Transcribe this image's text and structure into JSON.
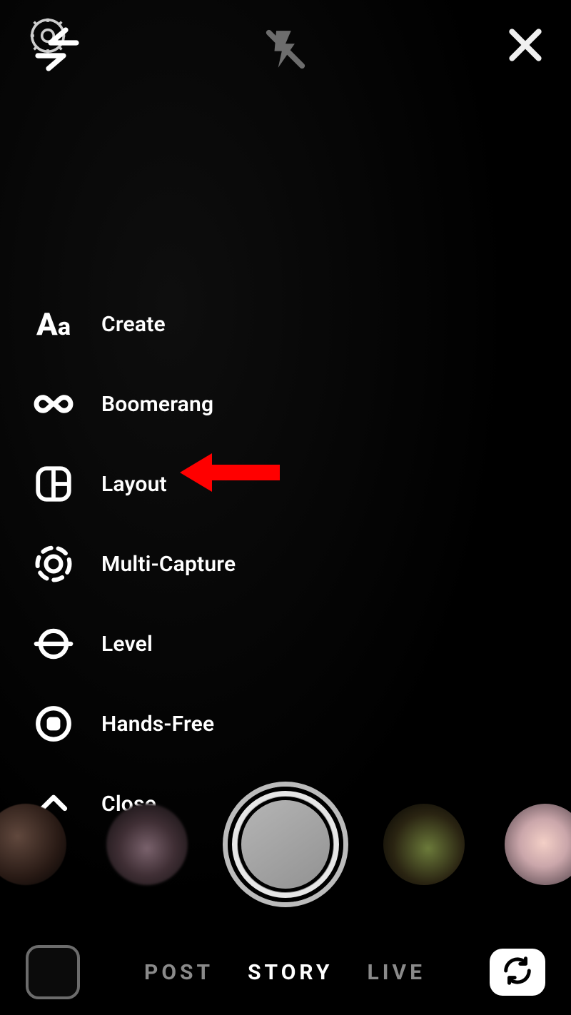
{
  "topbar": {
    "settings_icon": "gear-icon",
    "switch_icon": "switch-arrows-icon",
    "flash_icon": "flash-off-icon",
    "close_icon": "close-icon"
  },
  "tools": [
    {
      "id": "create",
      "icon": "text-aa-icon",
      "label": "Create"
    },
    {
      "id": "boomerang",
      "icon": "infinity-icon",
      "label": "Boomerang"
    },
    {
      "id": "layout",
      "icon": "layout-grid-icon",
      "label": "Layout"
    },
    {
      "id": "multicapture",
      "icon": "multi-capture-icon",
      "label": "Multi-Capture"
    },
    {
      "id": "level",
      "icon": "level-icon",
      "label": "Level"
    },
    {
      "id": "handsfree",
      "icon": "stop-circle-icon",
      "label": "Hands-Free"
    },
    {
      "id": "close",
      "icon": "chevron-up-icon",
      "label": "Close"
    }
  ],
  "annotation": {
    "target": "layout",
    "style": "red-arrow"
  },
  "filter_strip": {
    "items": [
      "filter-1",
      "filter-2",
      "filter-3",
      "filter-4"
    ],
    "shutter": "shutter-button"
  },
  "bottombar": {
    "gallery_icon": "gallery-thumb",
    "modes": [
      {
        "id": "post",
        "label": "POST",
        "active": false
      },
      {
        "id": "story",
        "label": "STORY",
        "active": true
      },
      {
        "id": "live",
        "label": "LIVE",
        "active": false
      }
    ],
    "flip_icon": "camera-flip-icon"
  }
}
